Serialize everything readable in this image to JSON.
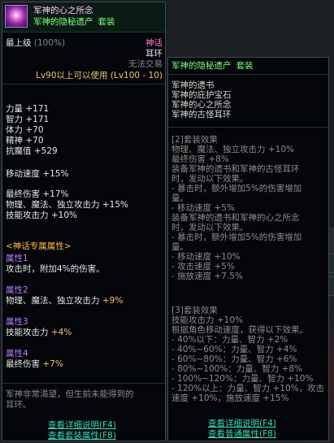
{
  "item": {
    "name": "军神的心之所念",
    "set_name": "军神的隐秘遗产",
    "set_tag": "套装",
    "grade": "最上级",
    "grade_pct": "(100%)",
    "rarity": "神话",
    "slot": "耳环",
    "trade": "无法交易",
    "level_req": "Lv90以上可以使用 (Lv100 - 10)"
  },
  "stats": [
    {
      "label": "力量",
      "value": "+171"
    },
    {
      "label": "智力",
      "value": "+171"
    },
    {
      "label": "体力",
      "value": "+70"
    },
    {
      "label": "精神",
      "value": "+70"
    },
    {
      "label": "抗魔值",
      "value": "+529"
    }
  ],
  "move_speed": {
    "label": "移动速度",
    "value": "+15%"
  },
  "final_damage": {
    "label": "最终伤害",
    "value": "+17%"
  },
  "phys_mag": {
    "label": "物理、魔法、独立攻击力",
    "value": "+15%"
  },
  "skill_atk": {
    "label": "技能攻击力",
    "value": "+10%"
  },
  "myth": {
    "header": "<神话专属属性>",
    "props": [
      {
        "title": "属性1",
        "desc": "攻击时，附加4%的伤害。",
        "value": ""
      },
      {
        "title": "属性2",
        "desc": "物理、魔法、独立攻击力",
        "value": "+9%"
      },
      {
        "title": "属性3",
        "desc": "技能攻击力",
        "value": "+4%"
      },
      {
        "title": "属性4",
        "desc": "最终伤害",
        "value": "+7%"
      }
    ]
  },
  "flavor": [
    "军神非常渴望，但生前未能得到的",
    "耳环。"
  ],
  "left_links": {
    "detail": "查看详细说明(F4)",
    "set": "查看套装属性(F8)"
  },
  "set_panel": {
    "title": "军神的隐秘遗产",
    "tag": "套装",
    "pieces": [
      "军神的遗书",
      "军神的庇护宝石",
      "军神的心之所念",
      "军神的古怪耳环"
    ],
    "effect2": [
      "[2]套装效果",
      "物理、魔法、独立攻击力 +10%",
      "最终伤害 +8%",
      "装备军神的遗书和军神的古怪耳环",
      "时，发动以下效果。",
      "- 暴击时，额外增加5%的伤害增加",
      "量。",
      "- 移动速度 +5%",
      "装备军神的遗书和军神的心之所念",
      "时，发动以下效果。",
      "- 暴击时，额外增加5%的伤害增加",
      "量。",
      "- 移动速度 +10%",
      "- 攻击速度 +5%",
      "- 施放速度 +7.5%"
    ],
    "effect3": [
      "[3]套装效果",
      "技能攻击力 +10%",
      "根据角色移动速度，获得以下效果。",
      "- 40%以下：力量、智力 +2%",
      "- 40%~60%：力量、智力 +4%",
      "- 60%~80%：力量、智力 +6%",
      "- 80%~100%：力量、智力 +8%",
      "- 100%~120%：力量、智力 +10%",
      "- 120%以上：力量、智力 +10%，攻击",
      "速度 +10%，施放速度 +15%"
    ],
    "links": {
      "detail": "查看详细说明(F4)",
      "normal": "查看普通属性(F8)"
    }
  }
}
